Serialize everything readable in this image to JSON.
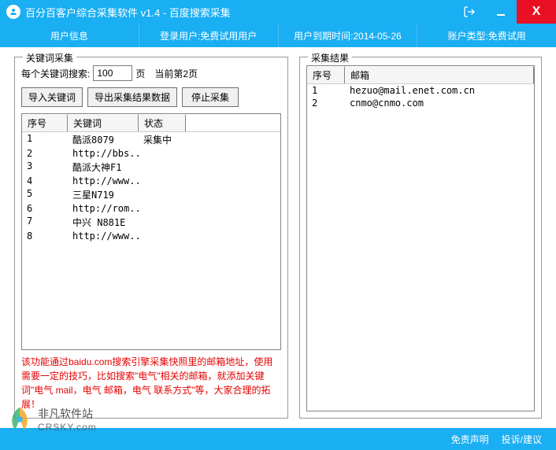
{
  "window": {
    "title": "百分百客户综合采集软件 v1.4 - 百度搜索采集"
  },
  "menubar": {
    "user_info": "用户信息",
    "login_user": "登录用户:免费试用用户",
    "expire": "用户到期时间:2014-05-26",
    "account_type": "账户类型:免费试用"
  },
  "left": {
    "legend": "关键词采集",
    "search_label_pre": "每个关键词搜索:",
    "pages_value": "100",
    "search_label_post": "页",
    "current_page": "当前第2页",
    "btn_import": "导入关键词",
    "btn_export": "导出采集结果数据",
    "btn_stop": "停止采集",
    "headers": {
      "seq": "序号",
      "keyword": "关键词",
      "status": "状态"
    },
    "rows": [
      {
        "seq": "1",
        "keyword": "酷派8079",
        "status": "采集中"
      },
      {
        "seq": "2",
        "keyword": "http://bbs....",
        "status": ""
      },
      {
        "seq": "3",
        "keyword": "酷派大神F1",
        "status": ""
      },
      {
        "seq": "4",
        "keyword": "http://www....",
        "status": ""
      },
      {
        "seq": "5",
        "keyword": "三星N719",
        "status": ""
      },
      {
        "seq": "6",
        "keyword": "http://rom....",
        "status": ""
      },
      {
        "seq": "7",
        "keyword": "中兴 N881E",
        "status": ""
      },
      {
        "seq": "8",
        "keyword": "http://www....",
        "status": ""
      }
    ],
    "note": "该功能通过baidu.com搜索引擎采集快照里的邮箱地址，使用需要一定的技巧，比如搜索\"电气\"相关的邮箱，就添加关键词\"电气 mail，电气 邮箱，电气 联系方式\"等，大家合理的拓展！"
  },
  "right": {
    "legend": "采集结果",
    "headers": {
      "seq": "序号",
      "email": "邮箱"
    },
    "rows": [
      {
        "seq": "1",
        "email": "hezuo@mail.enet.com.cn"
      },
      {
        "seq": "2",
        "email": "cnmo@cnmo.com"
      }
    ]
  },
  "footer": {
    "disclaimer": "免责声明",
    "feedback": "投诉/建议"
  },
  "watermark": {
    "text": "非凡软件站",
    "url": "CRSKY.com"
  }
}
